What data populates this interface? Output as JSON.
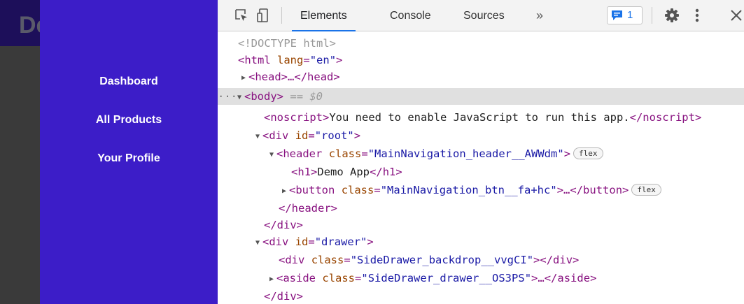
{
  "app": {
    "title": "Demo App",
    "nav": [
      "Dashboard",
      "All Products",
      "Your Profile"
    ]
  },
  "devtools": {
    "tabs": [
      "Elements",
      "Console",
      "Sources"
    ],
    "more_tabs": "»",
    "issues_count": "1",
    "icons": [
      "inspect-element-icon",
      "device-toolbar-icon",
      "issues-icon",
      "gear-icon",
      "kebab-menu-icon",
      "close-icon"
    ],
    "doctype": "<!DOCTYPE html>",
    "html_open": "html",
    "html_lang_attr": "lang",
    "html_lang_val": "en",
    "head_tag": "head",
    "body_tag": "body",
    "body_selected": "== $0",
    "noscript_tag": "noscript",
    "noscript_text": "You need to enable JavaScript to run this app.",
    "div_tag": "div",
    "id_attr": "id",
    "class_attr": "class",
    "root_id": "root",
    "header_tag": "header",
    "header_class": "MainNavigation_header__AWWdm",
    "h1_tag": "h1",
    "h1_text": "Demo App",
    "button_tag": "button",
    "button_class": "MainNavigation_btn__fa+hc",
    "drawer_id": "drawer",
    "backdrop_class": "SideDrawer_backdrop__vvgCI",
    "aside_tag": "aside",
    "aside_class": "SideDrawer_drawer__OS3PS",
    "flex_badge": "flex",
    "ellipsis": "…",
    "row_dots": "···"
  },
  "colors": {
    "drawer": "#3c1dc8",
    "app_header": "#1d0f5a",
    "tag": "#881280",
    "attr": "#994500",
    "value": "#1a1aa6",
    "active_tab": "#1a73e8"
  }
}
